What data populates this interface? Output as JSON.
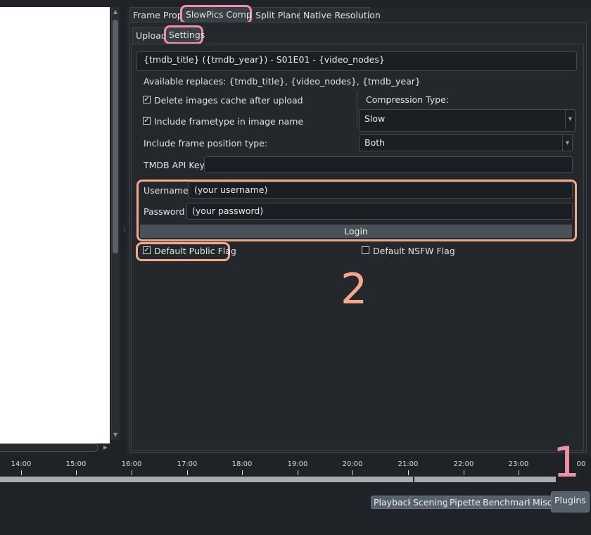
{
  "tabs": {
    "frame_props": "Frame Props",
    "slowpics_comps": "SlowPics Comps",
    "split_planes": "Split Planes",
    "native_resolution": "Native Resolution"
  },
  "subtabs": {
    "upload": "Upload",
    "settings": "Settings"
  },
  "settings": {
    "title_template": "{tmdb_title} ({tmdb_year}) - S01E01 - {video_nodes}",
    "available_replaces": "Available replaces: {tmdb_title}, {video_nodes}, {tmdb_year}",
    "delete_cache_label": "Delete images cache after upload",
    "delete_cache_checked": true,
    "include_frametype_label": "Include frametype in image name",
    "include_frametype_checked": true,
    "compression_type_label": "Compression Type:",
    "compression_type_value": "Slow",
    "frame_position_label": "Include frame position type:",
    "frame_position_value": "Both",
    "tmdb_api_key_label": "TMDB API Key",
    "tmdb_api_key_value": "",
    "username_label": "Username",
    "username_value": "(your username)",
    "password_label": "Password",
    "password_value": "(your password)",
    "login_label": "Login",
    "default_public_label": "Default Public Flag",
    "default_public_checked": true,
    "default_nsfw_label": "Default NSFW Flag",
    "default_nsfw_checked": false
  },
  "callouts": {
    "one": "1",
    "two": "2"
  },
  "timeline": {
    "ticks": [
      "14:00",
      "15:00",
      "16:00",
      "17:00",
      "18:00",
      "19:00",
      "20:00",
      "21:00",
      "22:00",
      "23:00",
      "00"
    ]
  },
  "toolbar": {
    "playback": "Playback",
    "scening": "Scening",
    "pipette": "Pipette",
    "benchmark": "Benchmark",
    "misc": "Misc",
    "plugins": "Plugins"
  },
  "colors": {
    "highlight_orange": "#f2a88a",
    "highlight_pink": "#ee8fa6"
  }
}
